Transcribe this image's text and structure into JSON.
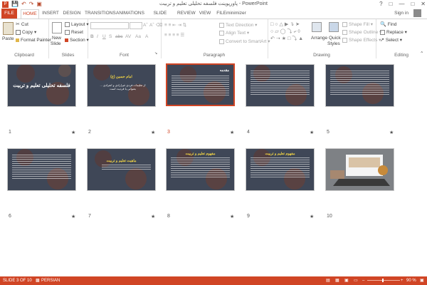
{
  "window": {
    "title": "پاورپوینت فلسفه تحلیلی تعلیم و تربیت - PowerPoint"
  },
  "qat": {
    "save_icon": "save-icon",
    "undo_icon": "undo-icon",
    "redo_icon": "redo-icon",
    "present_icon": "present-icon"
  },
  "tabs": [
    "FILE",
    "HOME",
    "INSERT",
    "DESIGN",
    "TRANSITIONS",
    "ANIMATIONS",
    "SLIDE SHOW",
    "REVIEW",
    "VIEW",
    "FILEminimizer"
  ],
  "account": {
    "signin": "Sign in"
  },
  "ribbon": {
    "clipboard": {
      "label": "Clipboard",
      "paste": "Paste",
      "cut": "Cut",
      "copy": "Copy",
      "format_painter": "Format Painter"
    },
    "slides": {
      "label": "Slides",
      "new_slide": "New",
      "new_slide2": "Slide",
      "layout": "Layout",
      "reset": "Reset",
      "section": "Section"
    },
    "font": {
      "label": "Font"
    },
    "paragraph": {
      "label": "Paragraph",
      "text_direction": "Text Direction",
      "align_text": "Align Text",
      "convert_smartart": "Convert to SmartArt"
    },
    "drawing": {
      "label": "Drawing",
      "arrange": "Arrange",
      "quick_styles": "Quick",
      "quick_styles2": "Styles",
      "shape_fill": "Shape Fill",
      "shape_outline": "Shape Outline",
      "shape_effects": "Shape Effects"
    },
    "editing": {
      "label": "Editing",
      "find": "Find",
      "replace": "Replace",
      "select": "Select"
    }
  },
  "slides": [
    {
      "num": "1",
      "title": "فلسفه تحلیلی تعلیم و تربیت"
    },
    {
      "num": "2",
      "title": "امام حسین (ع)",
      "subtitle": "از تعلیمات فردی غیرارادی و انفرادی ... بعنوانی یا فردیت است"
    },
    {
      "num": "3",
      "title": "مقدمه"
    },
    {
      "num": "4",
      "title": ""
    },
    {
      "num": "5",
      "title": ""
    },
    {
      "num": "6",
      "title": ""
    },
    {
      "num": "7",
      "title": "ماهیت تعلیم و تربیت"
    },
    {
      "num": "8",
      "title": "مفهوم تعلیم و تربیت"
    },
    {
      "num": "9",
      "title": "مفهوم تعلیم و تربیت"
    },
    {
      "num": "10",
      "title": ""
    }
  ],
  "status": {
    "slide_of": "SLIDE 3 OF 10",
    "language": "PERSIAN",
    "zoom": "90 %"
  },
  "colors": {
    "accent": "#d04525",
    "slide_bg": "#3d4654"
  }
}
